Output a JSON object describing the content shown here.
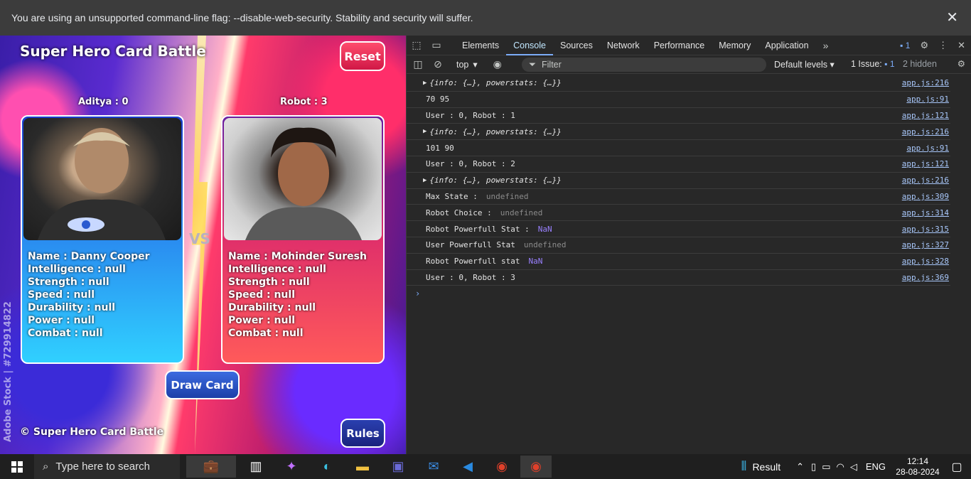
{
  "warning_bar": {
    "text": "You are using an unsupported command-line flag: --disable-web-security. Stability and security will suffer.",
    "close": "✕"
  },
  "game": {
    "title": "Super Hero Card Battle",
    "reset_label": "Reset",
    "draw_label": "Draw Card",
    "rules_label": "Rules",
    "vs": "VS",
    "footer": "© Super Hero Card Battle",
    "watermark": "Adobe Stock | #729914822",
    "user": {
      "score": "Aditya : 0",
      "name": "Name : Danny Cooper",
      "intelligence": "Intelligence : null",
      "strength": "Strength : null",
      "speed": "Speed : null",
      "durability": "Durability : null",
      "power": "Power : null",
      "combat": "Combat : null"
    },
    "robot": {
      "score": "Robot : 3",
      "name": "Name : Mohinder Suresh",
      "intelligence": "Intelligence : null",
      "strength": "Strength : null",
      "speed": "Speed : null",
      "durability": "Durability : null",
      "power": "Power : null",
      "combat": "Combat : null"
    }
  },
  "devtools": {
    "tabs": [
      "Elements",
      "Console",
      "Sources",
      "Network",
      "Performance",
      "Memory",
      "Application"
    ],
    "active_tab": "Console",
    "issue_badge": "1",
    "context": "top",
    "filter_placeholder": "Filter",
    "levels": "Default levels",
    "issues": "1 Issue:",
    "issues_count": "1",
    "hidden": "2 hidden",
    "console_rows": [
      {
        "text": "{info: {…}, powerstats: {…}}",
        "src": "app.js:216",
        "kind": "obj"
      },
      {
        "text": "70 95",
        "src": "app.js:91",
        "kind": "plain"
      },
      {
        "text": "User : 0, Robot : 1",
        "src": "app.js:121",
        "kind": "plain"
      },
      {
        "text": "{info: {…}, powerstats: {…}}",
        "src": "app.js:216",
        "kind": "obj"
      },
      {
        "text": "101 90",
        "src": "app.js:91",
        "kind": "plain"
      },
      {
        "text": "User : 0, Robot : 2",
        "src": "app.js:121",
        "kind": "plain"
      },
      {
        "text": "{info: {…}, powerstats: {…}}",
        "src": "app.js:216",
        "kind": "obj"
      },
      {
        "text": "Max State :",
        "value": "undefined",
        "src": "app.js:309",
        "kind": "undef"
      },
      {
        "text": "Robot Choice :",
        "value": "undefined",
        "src": "app.js:314",
        "kind": "undef"
      },
      {
        "text": "Robot Powerfull Stat :",
        "value": "NaN",
        "src": "app.js:315",
        "kind": "nan"
      },
      {
        "text": "User Powerfull Stat",
        "value": "undefined",
        "src": "app.js:327",
        "kind": "undef"
      },
      {
        "text": "Robot Powerfull stat",
        "value": "NaN",
        "src": "app.js:328",
        "kind": "nan"
      },
      {
        "text": "User : 0, Robot : 3",
        "src": "app.js:369",
        "kind": "plain"
      }
    ]
  },
  "taskbar": {
    "search_placeholder": "Type here to search",
    "weather": "Result",
    "lang": "ENG",
    "time": "12:14",
    "date": "28-08-2024"
  }
}
